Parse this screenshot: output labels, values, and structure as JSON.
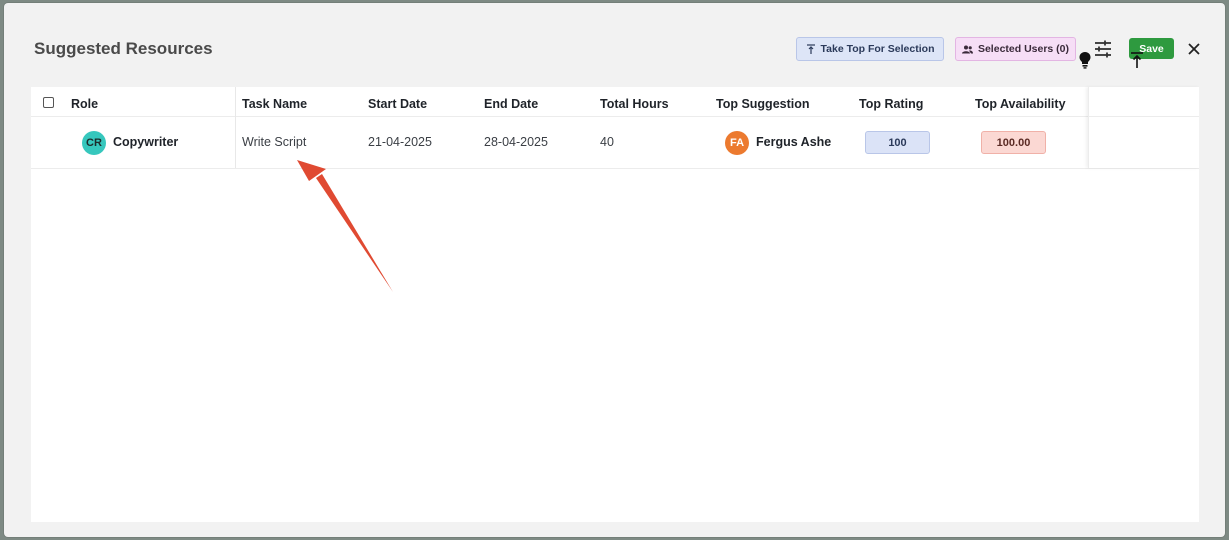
{
  "modal": {
    "title": "Suggested Resources",
    "take_top_label": "Take Top For Selection",
    "selected_users_label": "Selected Users (0)",
    "save_label": "Save"
  },
  "table": {
    "headers": {
      "role": "Role",
      "task_name": "Task Name",
      "start_date": "Start Date",
      "end_date": "End Date",
      "total_hours": "Total Hours",
      "top_suggestion": "Top Suggestion",
      "top_rating": "Top Rating",
      "top_availability": "Top Availability"
    },
    "rows": [
      {
        "role_initials": "CR",
        "role": "Copywriter",
        "task_name": "Write Script",
        "start_date": "21-04-2025",
        "end_date": "28-04-2025",
        "total_hours": "40",
        "suggestion_initials": "FA",
        "top_suggestion": "Fergus Ashe",
        "top_rating": "100",
        "top_availability": "100.00"
      }
    ]
  },
  "colors": {
    "save": "#2e9a3f",
    "take_top_bg": "#dde5f7",
    "selected_users_bg": "#f6def6",
    "rating_bg": "#dbe3f7",
    "availability_bg": "#fbd8d3",
    "annotation_arrow": "#e04a32"
  },
  "icons": [
    "take-top-icon",
    "users-icon",
    "tune-icon",
    "close-icon",
    "bulb-icon",
    "align-top-icon"
  ]
}
